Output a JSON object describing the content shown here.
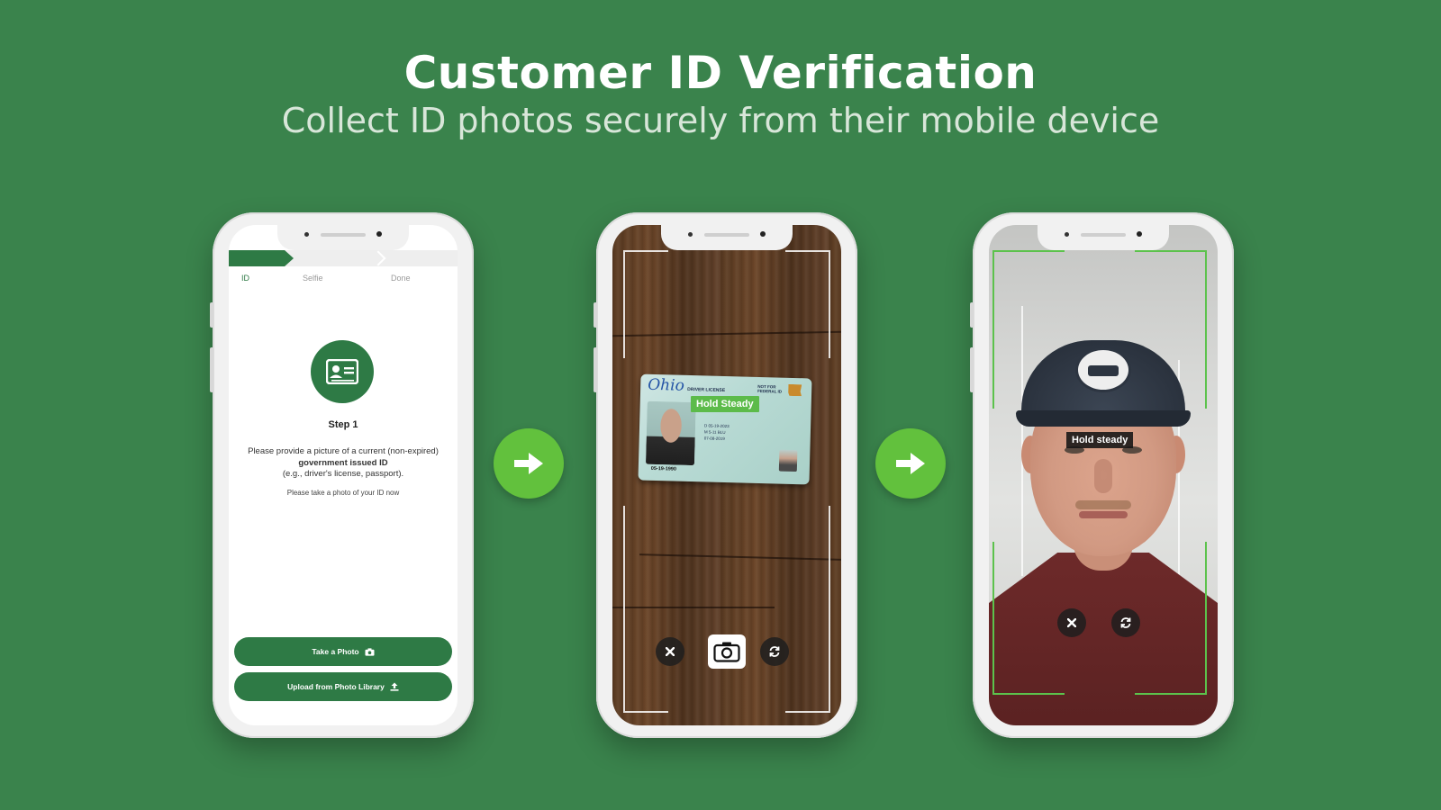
{
  "hero": {
    "title": "Customer ID Verification",
    "subtitle": "Collect ID photos securely from their mobile device"
  },
  "phone1": {
    "steps": [
      "ID",
      "Selfie",
      "Done"
    ],
    "active_step": "ID",
    "step_title": "Step 1",
    "desc_line1": "Please provide a picture of a current (non-expired)",
    "desc_bold": "government issued ID",
    "desc_line3": "(e.g., driver's license, passport).",
    "note": "Please take a photo of your ID now",
    "take_photo_label": "Take a Photo",
    "upload_label": "Upload from Photo Library",
    "icons": {
      "step": "id-card-icon",
      "take": "camera-icon",
      "upload": "upload-icon"
    }
  },
  "phone2": {
    "overlay": "Hold Steady",
    "id_card": {
      "state": "Ohio",
      "doc_type": "DRIVER LICENSE",
      "fed_line1": "NOT FOR",
      "fed_line2": "FEDERAL ID",
      "dob": "05-19-1990",
      "field_exp": "D   05-19-2023",
      "field_sex": "M   5-11  BLU",
      "field_iss": "07-08-2019"
    },
    "controls": [
      "close-icon",
      "camera-icon",
      "flip-camera-icon"
    ]
  },
  "phone3": {
    "overlay": "Hold steady",
    "controls": [
      "close-icon",
      "flip-camera-icon"
    ]
  },
  "colors": {
    "background": "#3a834c",
    "brand_green": "#2e7a45",
    "accent_green": "#62c13d",
    "frame_green": "#5cc24c"
  }
}
